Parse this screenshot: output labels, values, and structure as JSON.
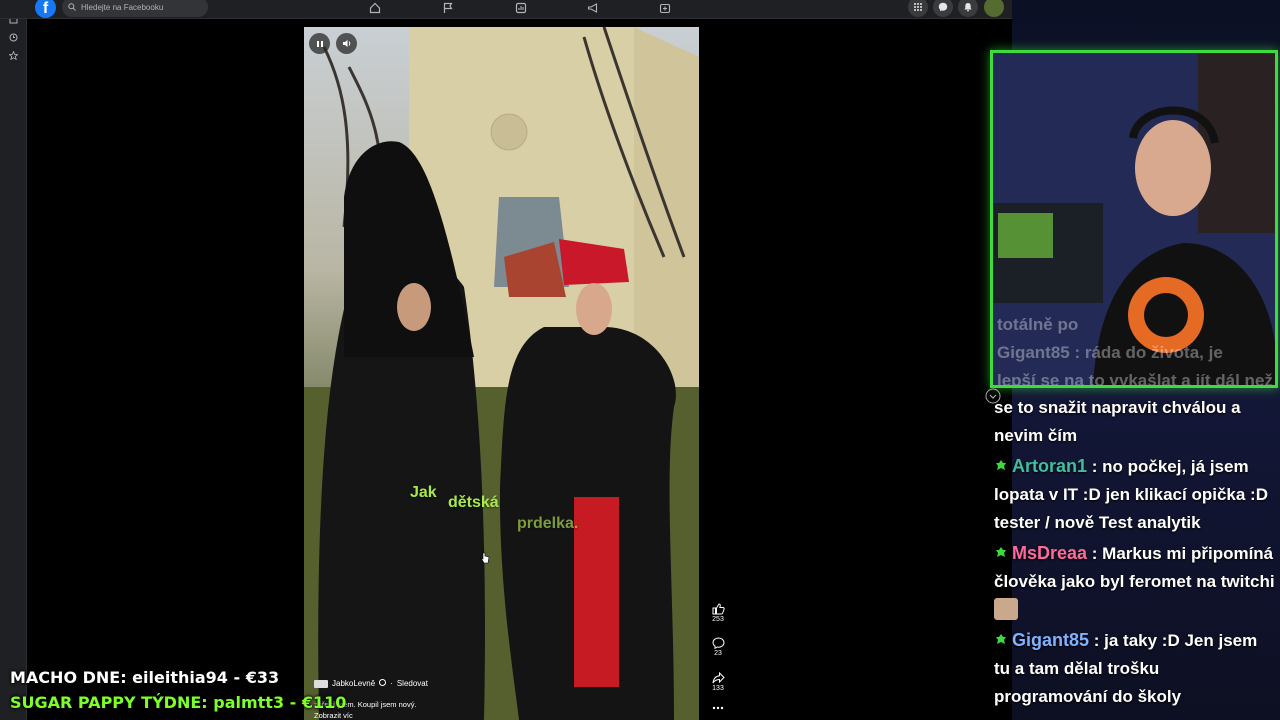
{
  "facebook": {
    "search_placeholder": "Hledejte na Facebooku",
    "reel": {
      "caption_words": [
        "Jak",
        "dětská",
        "prdelka."
      ],
      "author": "JabkoLevně",
      "follow_label": "Sledovat",
      "description": "zhřešil jsem. Koupil jsem nový.",
      "see_more_label": "Zobrazit víc",
      "likes": "253",
      "comments": "23",
      "shares": "133"
    }
  },
  "stream": {
    "chat": [
      {
        "user": "",
        "text": "se to snažit napravit chválou a nevim čím",
        "color": "#ffffff"
      },
      {
        "user": "Artoran1",
        "text": " : no počkej, já jsem lopata v IT :D jen klikací opička :D tester / nově Test analytik",
        "color": "#3fbf9f"
      },
      {
        "user": "MsDreaa",
        "text": " : Markus mi připomíná člověka jako byl feromet na twitchi",
        "color": "#ff6a9a"
      },
      {
        "user": "Gigant85",
        "text": " : ja taky :D Jen jsem tu a tam dělal trošku programování do školy",
        "color": "#7fb2ff"
      }
    ],
    "cam_overlay_chat": [
      "totálně po",
      "Gigant85 : ráda do života, je",
      "lepší se na to vykašlat a jít dál než"
    ],
    "macho_label": "MACHO DNE: eileithia94 - €33",
    "sugar_label": "SUGAR PAPPY TÝDNE: palmtt3 - €110"
  },
  "colors": {
    "accent_green": "#3bdc3b",
    "fb_blue": "#1877f2",
    "macho": "#ffffff",
    "sugar": "#7dff2a"
  }
}
